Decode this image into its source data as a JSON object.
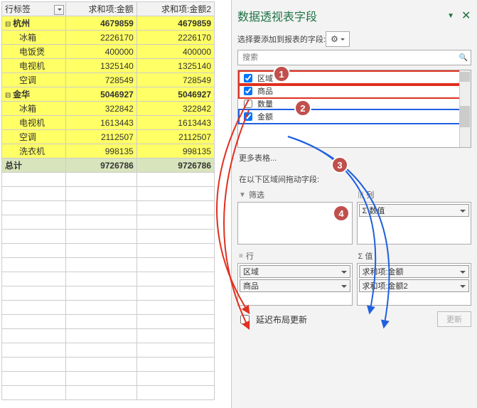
{
  "table": {
    "headers": [
      "行标签",
      "求和项:金额",
      "求和项:金额2"
    ],
    "groups": [
      {
        "name": "杭州",
        "sum1": "4679859",
        "sum2": "4679859",
        "rows": [
          {
            "name": "冰箱",
            "v1": "2226170",
            "v2": "2226170"
          },
          {
            "name": "电饭煲",
            "v1": "400000",
            "v2": "400000"
          },
          {
            "name": "电视机",
            "v1": "1325140",
            "v2": "1325140"
          },
          {
            "name": "空调",
            "v1": "728549",
            "v2": "728549"
          }
        ]
      },
      {
        "name": "金华",
        "sum1": "5046927",
        "sum2": "5046927",
        "rows": [
          {
            "name": "冰箱",
            "v1": "322842",
            "v2": "322842"
          },
          {
            "name": "电视机",
            "v1": "1613443",
            "v2": "1613443"
          },
          {
            "name": "空调",
            "v1": "2112507",
            "v2": "2112507"
          },
          {
            "name": "洗衣机",
            "v1": "998135",
            "v2": "998135"
          }
        ]
      }
    ],
    "total": {
      "label": "总计",
      "v1": "9726786",
      "v2": "9726786"
    }
  },
  "pane": {
    "title": "数据透视表字段",
    "subtitle": "选择要添加到报表的字段:",
    "search_placeholder": "搜索",
    "fields": [
      {
        "label": "区域",
        "checked": true
      },
      {
        "label": "商品",
        "checked": true
      },
      {
        "label": "数量",
        "checked": false
      },
      {
        "label": "金额",
        "checked": true
      }
    ],
    "more": "更多表格...",
    "drag_title": "在以下区域间拖动字段:",
    "zones": {
      "filter": {
        "title": "筛选",
        "items": []
      },
      "cols": {
        "title": "列",
        "items": [
          "Σ 数值"
        ]
      },
      "rows": {
        "title": "行",
        "items": [
          "区域",
          "商品"
        ]
      },
      "vals": {
        "title": "Σ 值",
        "items": [
          "求和项:金额",
          "求和项:金额2"
        ]
      }
    },
    "defer": "延迟布局更新",
    "update": "更新"
  },
  "badges": [
    "1",
    "2",
    "3",
    "4"
  ]
}
